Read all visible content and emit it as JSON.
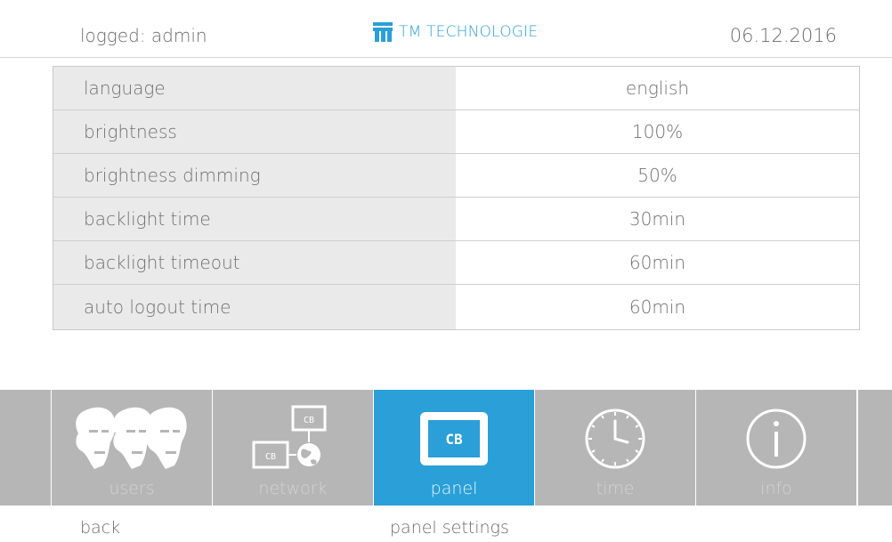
{
  "header": {
    "logged_user": "logged: admin",
    "brand": "TM TECHNOLOGIE",
    "date": "06.12.2016"
  },
  "settings": [
    {
      "label": "language",
      "value": "english"
    },
    {
      "label": "brightness",
      "value": "100%"
    },
    {
      "label": "brightness dimming",
      "value": "50%"
    },
    {
      "label": "backlight time",
      "value": "30min"
    },
    {
      "label": "backlight timeout",
      "value": "60min"
    },
    {
      "label": "auto logout time",
      "value": "60min"
    }
  ],
  "nav": {
    "active": "panel",
    "items": [
      {
        "label": "users",
        "icon": "users-faces-icon"
      },
      {
        "label": "network",
        "icon": "network-cb-icon",
        "badge_top": "CB",
        "badge_left": "CB"
      },
      {
        "label": "panel",
        "icon": "panel-cb-icon",
        "badge": "CB"
      },
      {
        "label": "time",
        "icon": "clock-icon"
      },
      {
        "label": "info",
        "icon": "info-icon"
      }
    ]
  },
  "footer": {
    "back_label": "back",
    "page_title": "panel settings"
  },
  "colors": {
    "accent": "#2a9fd8",
    "nav_bg": "#b6b6b6",
    "label_bg": "#eaeaea",
    "text": "#707070"
  }
}
